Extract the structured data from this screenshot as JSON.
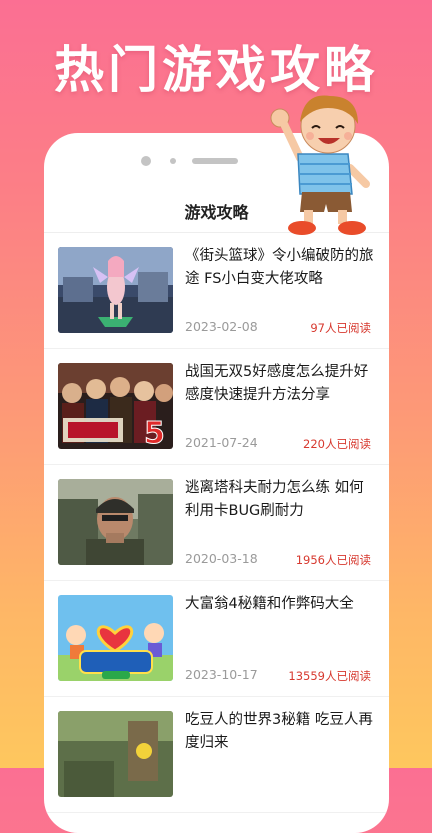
{
  "banner": {
    "headline": "热门游戏攻略"
  },
  "page": {
    "title": "游戏攻略"
  },
  "articles": [
    {
      "title": "《街头篮球》令小编破防的旅途 FS小白变大佬攻略",
      "date": "2023-02-08",
      "reads": "97人已阅读",
      "thumb": "anime-dancer-icon"
    },
    {
      "title": "战国无双5好感度怎么提升好感度快速提升方法分享",
      "date": "2021-07-24",
      "reads": "220人已阅读",
      "thumb": "samurai-warriors-icon"
    },
    {
      "title": "逃离塔科夫耐力怎么练 如何利用卡BUG刷耐力",
      "date": "2020-03-18",
      "reads": "1956人已阅读",
      "thumb": "soldier-icon"
    },
    {
      "title": "大富翁4秘籍和作弊码大全",
      "date": "2023-10-17",
      "reads": "13559人已阅读",
      "thumb": "richman-logo-icon"
    },
    {
      "title": "吃豆人的世界3秘籍 吃豆人再度归来",
      "date": "",
      "reads": "",
      "thumb": "pacman-world-icon"
    }
  ]
}
